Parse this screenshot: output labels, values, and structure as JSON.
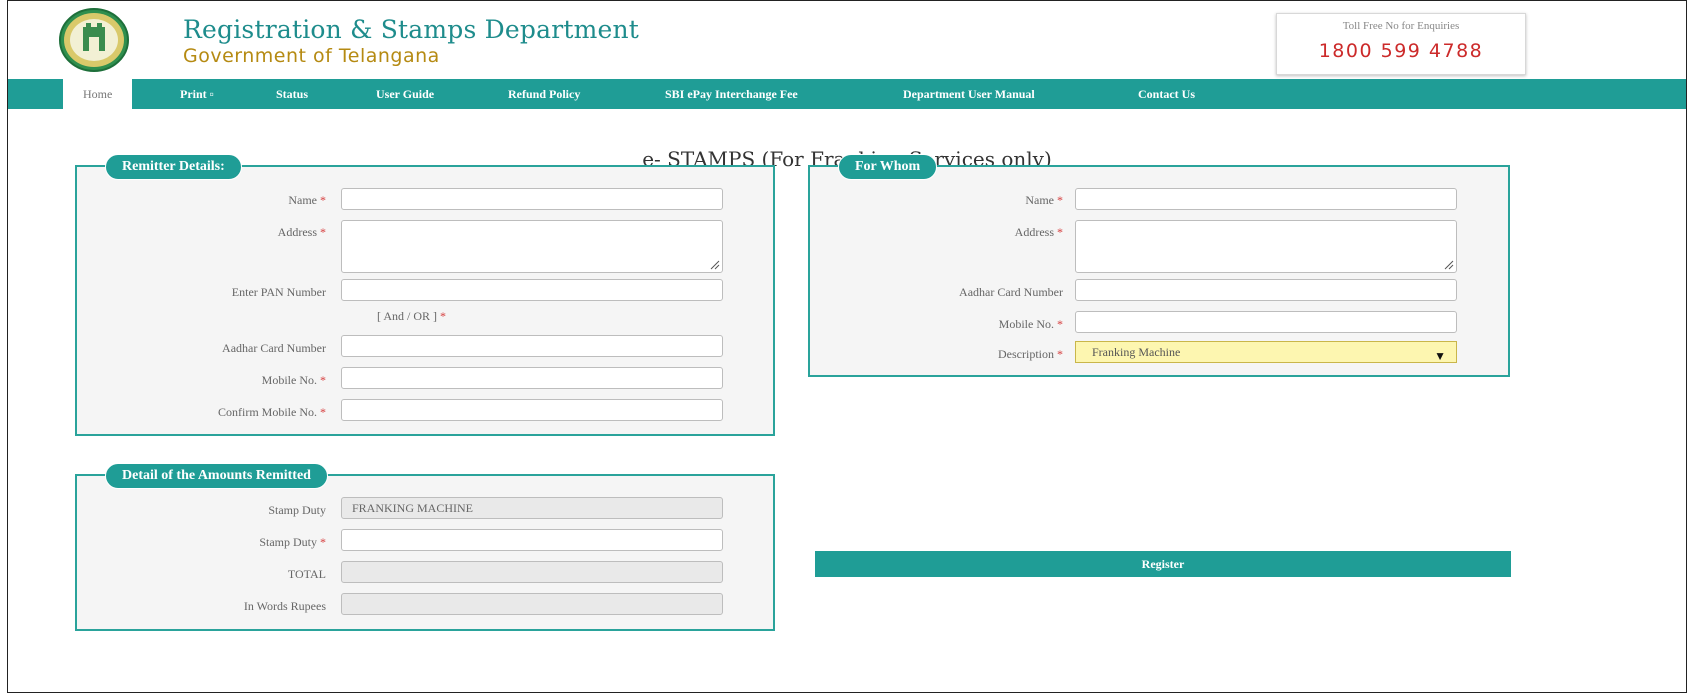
{
  "header": {
    "title": "Registration & Stamps Department",
    "subtitle": "Government of Telangana",
    "toll_free_label": "Toll Free No for Enquiries",
    "toll_free_number": "1800 599 4788",
    "logo_icon": "telangana-emblem-icon"
  },
  "nav": {
    "items": [
      {
        "label": "Home"
      },
      {
        "label": "Print ▫"
      },
      {
        "label": "Status"
      },
      {
        "label": "User Guide"
      },
      {
        "label": "Refund Policy"
      },
      {
        "label": "SBI ePay Interchange Fee"
      },
      {
        "label": "Department User Manual"
      },
      {
        "label": "Contact Us"
      }
    ]
  },
  "page": {
    "heading": "e- STAMPS (For Franking Services only)"
  },
  "remitter": {
    "legend": "Remitter Details:",
    "name_label": "Name",
    "address_label": "Address",
    "pan_label": "Enter PAN Number",
    "and_or": "[ And / OR ]",
    "aadhar_label": "Aadhar Card Number",
    "mobile_label": "Mobile No.",
    "confirm_mobile_label": "Confirm Mobile No.",
    "required_mark": "*"
  },
  "for_whom": {
    "legend": "For Whom",
    "name_label": "Name",
    "address_label": "Address",
    "aadhar_label": "Aadhar Card Number",
    "mobile_label": "Mobile No.",
    "description_label": "Description",
    "description_value": "Franking Machine",
    "required_mark": "*"
  },
  "amounts": {
    "legend": "Detail of the Amounts Remitted",
    "stamp_duty_type_label": "Stamp Duty",
    "stamp_duty_type_value": "FRANKING MACHINE",
    "stamp_duty_label": "Stamp Duty",
    "total_label": "TOTAL",
    "in_words_label": "In Words Rupees",
    "required_mark": "*"
  },
  "actions": {
    "register_label": "Register"
  },
  "colors": {
    "teal": "#1f9d96",
    "title": "#1e8c8c",
    "subtitle": "#b58a12",
    "toll_number": "#cc2a2a",
    "select_bg": "#fdf6b0"
  }
}
